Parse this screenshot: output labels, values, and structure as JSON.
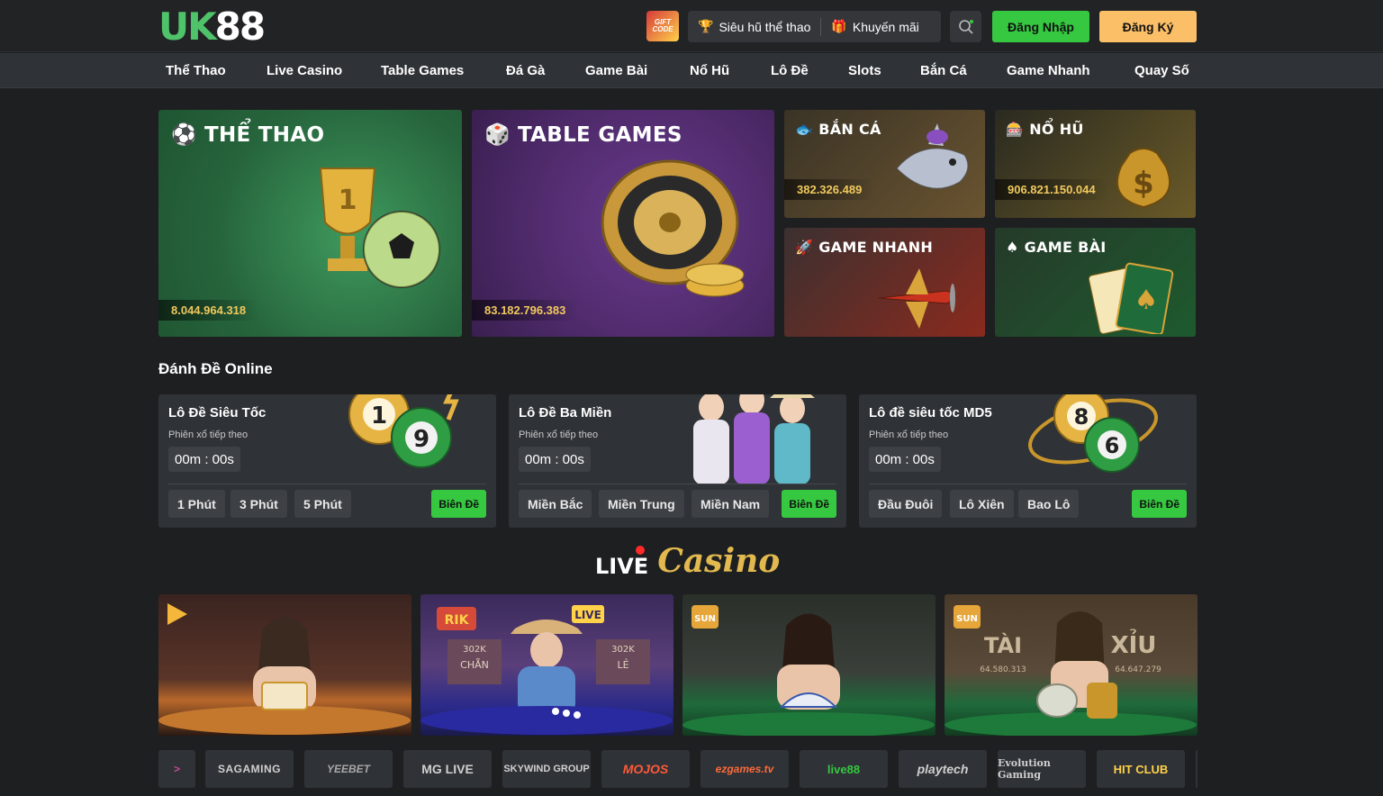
{
  "header": {
    "logo": {
      "part1": "UK",
      "part2": "88"
    },
    "gift_code": "GIFT CODE",
    "sieu_hu": "Siêu hũ thể thao",
    "khuyen_mai": "Khuyến mãi",
    "login": "Đăng Nhập",
    "register": "Đăng Ký"
  },
  "nav": [
    "Thể Thao",
    "Live Casino",
    "Table Games",
    "Đá Gà",
    "Game Bài",
    "Nổ Hũ",
    "Lô Đề",
    "Slots",
    "Bắn Cá",
    "Game Nhanh",
    "Quay Số"
  ],
  "games": {
    "the_thao": {
      "title": "THỂ THAO",
      "value": "8.044.964.318"
    },
    "table_games": {
      "title": "TABLE GAMES",
      "value": "83.182.796.383"
    },
    "ban_ca": {
      "title": "BẮN CÁ",
      "value": "382.326.489"
    },
    "no_hu": {
      "title": "NỔ HŨ",
      "value": "906.821.150.044"
    },
    "game_nhanh": {
      "title": "GAME NHANH"
    },
    "game_bai": {
      "title": "GAME BÀI"
    }
  },
  "lode": {
    "section_title": "Đánh Đề Online",
    "cards": [
      {
        "name": "Lô Đề Siêu Tốc",
        "sub": "Phiên xổ tiếp theo",
        "timer": "00m : 00s",
        "options": [
          "1 Phút",
          "3 Phút",
          "5 Phút"
        ],
        "action": "Biên Đề",
        "balls": [
          "1",
          "9"
        ]
      },
      {
        "name": "Lô Đề Ba Miền",
        "sub": "Phiên xổ tiếp theo",
        "timer": "00m : 00s",
        "options": [
          "Miền Bắc",
          "Miền Trung",
          "Miền Nam"
        ],
        "action": "Biên Đề"
      },
      {
        "name": "Lô đề siêu tốc MD5",
        "sub": "Phiên xổ tiếp theo",
        "timer": "00m : 00s",
        "options": [
          "Đầu Đuôi",
          "Lô Xiên",
          "Bao Lô"
        ],
        "action": "Biên Đề",
        "balls": [
          "8",
          "6"
        ]
      }
    ]
  },
  "live_casino": {
    "title_live": "LIVE",
    "title_casino": "Casino",
    "tables": [
      {
        "labels": []
      },
      {
        "labels": [
          "RIK",
          "LIVE",
          "302K",
          "CHẴN",
          "302K",
          "LẺ"
        ]
      },
      {
        "labels": [
          "SUN"
        ]
      },
      {
        "labels": [
          "SUN",
          "TÀI",
          "XỈU",
          "64.580.313",
          "64.647.279"
        ]
      }
    ]
  },
  "providers": [
    "SAGAMING",
    "YEEBET",
    "MG LIVE",
    "SKYWIND GROUP",
    "MOJOS",
    "ezgames.tv",
    "live88",
    "playtech",
    "Evolution Gaming",
    "HIT CLUB"
  ],
  "colors": {
    "green": "#35c840",
    "gold": "#f0c95d",
    "orange": "#fbbf68",
    "bg": "#1e1f21",
    "panel": "#2f3236"
  }
}
